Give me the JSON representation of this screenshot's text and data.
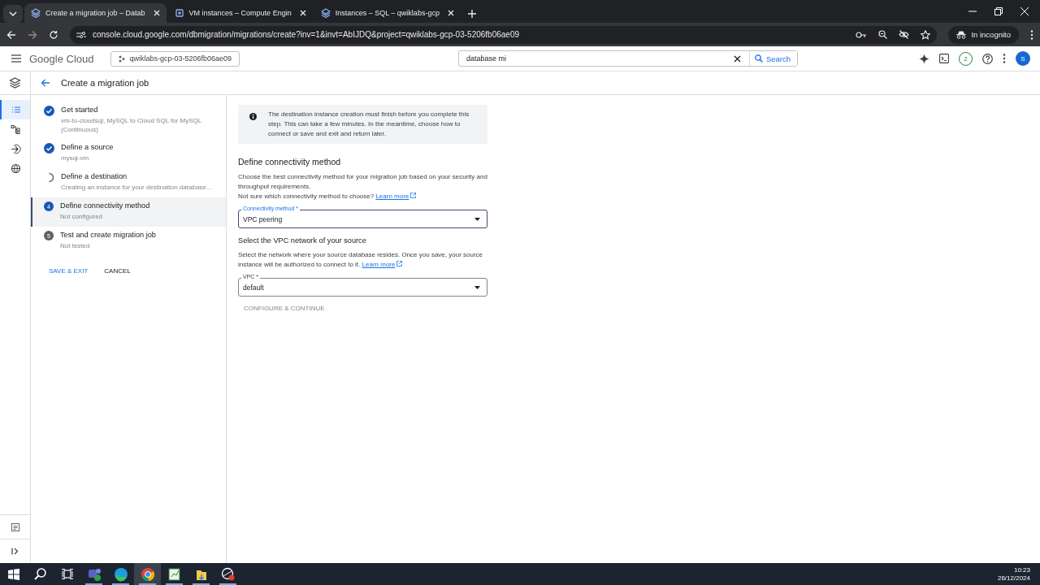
{
  "browser": {
    "tabs": [
      {
        "title": "Create a migration job – Datab",
        "selected": true
      },
      {
        "title": "VM instances – Compute Engin",
        "selected": false
      },
      {
        "title": "Instances – SQL – qwiklabs-gcp",
        "selected": false
      }
    ],
    "url": "console.cloud.google.com/dbmigration/migrations/create?inv=1&invt=AbIJDQ&project=qwiklabs-gcp-03-5206fb06ae09",
    "incognito": "In incognito"
  },
  "header": {
    "brand": "Google Cloud",
    "project": "qwiklabs-gcp-03-5206fb06ae09",
    "search": {
      "value": "database mi",
      "button": "Search"
    },
    "notifications": "2",
    "avatar": "S"
  },
  "rail": [
    {
      "selected": true
    },
    {
      "selected": false
    },
    {
      "selected": false
    },
    {
      "selected": false
    }
  ],
  "page": {
    "title": "Create a migration job",
    "steps": [
      {
        "title": "Get started",
        "subtitle": "vm-to-cloudsql, MySQL to Cloud SQL for MySQL (Continuous)",
        "kind": "done",
        "selected": false
      },
      {
        "title": "Define a source",
        "subtitle": "mysql-vm",
        "kind": "done",
        "selected": false
      },
      {
        "title": "Define a destination",
        "subtitle": "Creating an instance for your destination database...",
        "kind": "loading",
        "selected": false
      },
      {
        "title": "Define connectivity method",
        "subtitle": "Not configured",
        "kind": "numbered",
        "number": "4",
        "selected": true
      },
      {
        "title": "Test and create migration job",
        "subtitle": "Not tested",
        "kind": "numbered",
        "number": "5",
        "selected": false
      }
    ],
    "save": "SAVE & EXIT",
    "cancel": "CANCEL"
  },
  "content": {
    "notice": "The destination instance creation must finish before you complete this step. This can take a few minutes. In the meantime, choose how to connect or save and exit and return later.",
    "heading": "Define connectivity method",
    "description": "Choose the best connectivity method for your migration job based on your security and throughput requirements.",
    "help": "Not sure which connectivity method to choose?",
    "help_link": "Learn more",
    "method": {
      "label": "Connectivity method *",
      "value": "VPC peering",
      "focused": true
    },
    "vpc_heading": "Select the VPC network of your source",
    "vpc_description": "Select the network where your source database resides. Once you save, your source instance will be authorized to connect to it.",
    "vpc_link": "Learn more",
    "vpc": {
      "label": "VPC *",
      "value": "default",
      "focused": false
    },
    "configure": {
      "label": "CONFIGURE & CONTINUE",
      "disabled": true
    }
  },
  "taskbar": {
    "apps": [
      {
        "selected": false
      },
      {
        "selected": false
      },
      {
        "selected": true
      },
      {
        "selected": false
      },
      {
        "selected": false
      },
      {
        "selected": false
      }
    ],
    "time": "10:23",
    "date": "26/12/2024"
  }
}
